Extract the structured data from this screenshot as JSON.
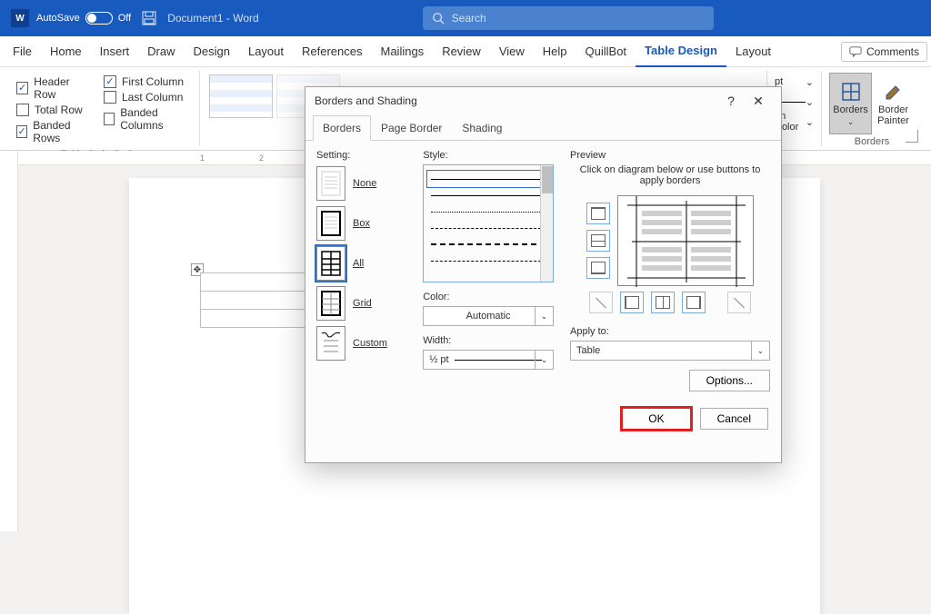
{
  "title": {
    "autosave": "AutoSave",
    "autosave_state": "Off",
    "docname": "Document1  -  Word",
    "search_placeholder": "Search"
  },
  "menu": {
    "tabs": [
      "File",
      "Home",
      "Insert",
      "Draw",
      "Design",
      "Layout",
      "References",
      "Mailings",
      "Review",
      "View",
      "Help",
      "QuillBot",
      "Table Design",
      "Layout"
    ],
    "active": "Table Design",
    "comments": "Comments"
  },
  "ribbon": {
    "styleopts": {
      "header_row": "Header Row",
      "total_row": "Total Row",
      "banded_rows": "Banded Rows",
      "first_col": "First Column",
      "last_col": "Last Column",
      "banded_cols": "Banded Columns",
      "group": "Table Style Options"
    },
    "end": {
      "pt": "pt",
      "pencolor": "en Color",
      "borders": "Borders",
      "painter": "Border Painter",
      "group": "Borders"
    }
  },
  "dialog": {
    "title": "Borders and Shading",
    "tabs": {
      "borders": "Borders",
      "page": "Page Border",
      "shading": "Shading"
    },
    "setting": {
      "label": "Setting:",
      "none": "None",
      "box": "Box",
      "all": "All",
      "grid": "Grid",
      "custom": "Custom"
    },
    "style": {
      "label": "Style:",
      "color": "Color:",
      "color_value": "Automatic",
      "width": "Width:",
      "width_value": "½ pt"
    },
    "preview": {
      "label": "Preview",
      "hint": "Click on diagram below or use buttons to apply borders",
      "applyto": "Apply to:",
      "applyto_value": "Table",
      "options": "Options..."
    },
    "ok": "OK",
    "cancel": "Cancel"
  },
  "ui": {
    "help": "?",
    "close": "✕",
    "dd": "⌄"
  }
}
